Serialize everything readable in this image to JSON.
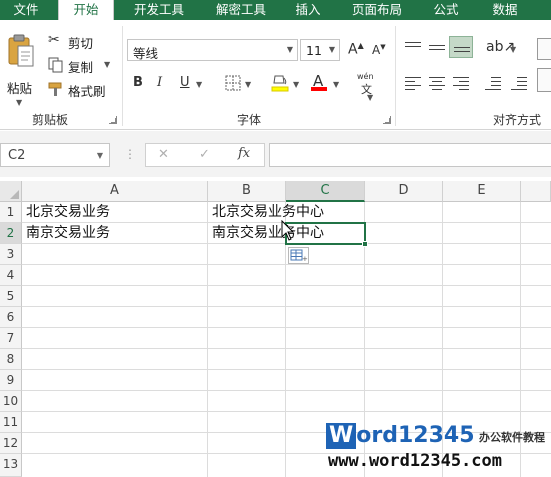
{
  "tabs": [
    "文件",
    "开始",
    "开发工具",
    "解密工具",
    "插入",
    "页面布局",
    "公式",
    "数据"
  ],
  "active_tab": "开始",
  "clipboard": {
    "paste_label": "粘贴",
    "cut_label": "剪切",
    "copy_label": "复制",
    "format_painter_label": "格式刷",
    "group_label": "剪贴板"
  },
  "font": {
    "font_name": "等线",
    "font_size": "11",
    "bold": "B",
    "italic": "I",
    "underline": "U",
    "phonetic_label": "wén",
    "group_label": "字体",
    "accent_color": "#217346",
    "highlight_color": "#ffff00",
    "font_color": "#ff0000"
  },
  "alignment": {
    "group_label": "对齐方式"
  },
  "formula_bar": {
    "name_box": "C2",
    "cancel": "✕",
    "enter": "✓",
    "fx": "fx",
    "formula": ""
  },
  "sheet": {
    "columns": [
      "A",
      "B",
      "C",
      "D",
      "E"
    ],
    "selected_column": "C",
    "rows": [
      "1",
      "2",
      "3",
      "4",
      "5",
      "6",
      "7",
      "8",
      "9",
      "10",
      "11",
      "12",
      "13"
    ],
    "selected_row": "2",
    "active_cell": "C2",
    "cells": {
      "A1": "北京交易业务",
      "B1": "北京交易业务中心",
      "A2": "南京交易业务",
      "B2": "南京交易业务中心"
    }
  },
  "watermark": {
    "logo_w": "W",
    "logo_rest": "ord12345",
    "side_text": "办公软件教程",
    "url": "www.word12345.com"
  }
}
